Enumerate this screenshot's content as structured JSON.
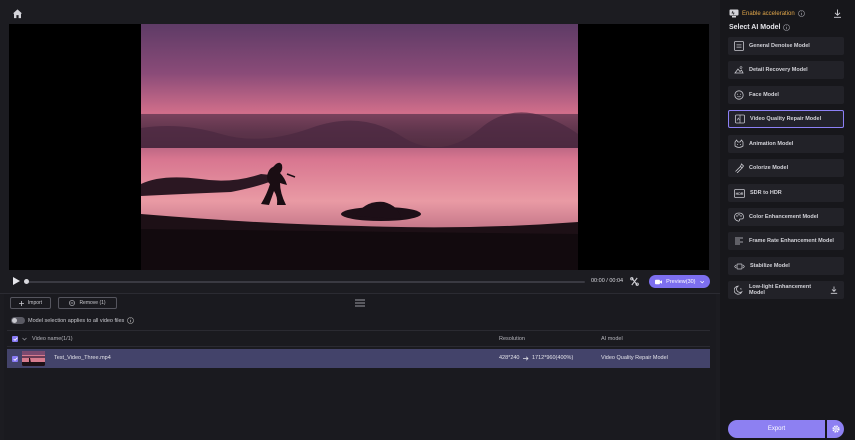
{
  "player": {
    "timecode": "00:00 / 00:04",
    "progress": 0,
    "preview_label": "Preview(30)"
  },
  "toolbar": {
    "import_label": "Import",
    "remove_label": "Remove (1)"
  },
  "toggle": {
    "label": "Model selection applies to all video files",
    "on": false
  },
  "table": {
    "headers": {
      "name": "Video name(1/1)",
      "resolution": "Resolution",
      "model": "AI model"
    },
    "rows": [
      {
        "name": "Test_Video_Three.mp4",
        "res_from": "428*240",
        "res_to": "1712*960(400%)",
        "model": "Video Quality Repair Model",
        "checked": true
      }
    ]
  },
  "side": {
    "accel_label": "Enable acceleration",
    "title": "Select AI Model",
    "models": [
      {
        "label": "General Denoise Model",
        "icon": "denoise-icon",
        "selected": false
      },
      {
        "label": "Detail Recovery Model",
        "icon": "detail-icon",
        "selected": false
      },
      {
        "label": "Face Model",
        "icon": "face-icon",
        "selected": false
      },
      {
        "label": "Video Quality Repair Model",
        "icon": "repair-icon",
        "selected": true
      },
      {
        "label": "Animation Model",
        "icon": "animation-icon",
        "selected": false
      },
      {
        "label": "Colorize Model",
        "icon": "colorize-icon",
        "selected": false
      },
      {
        "label": "SDR to HDR",
        "icon": "hdr-icon",
        "selected": false
      },
      {
        "label": "Color Enhancement Model",
        "icon": "color-enhance-icon",
        "selected": false
      },
      {
        "label": "Frame Rate Enhancement Model",
        "icon": "frame-rate-icon",
        "selected": false
      },
      {
        "label": "Stabilize Model",
        "icon": "stabilize-icon",
        "selected": false
      },
      {
        "label": "Low-light Enhancement Model",
        "icon": "low-light-icon",
        "selected": false,
        "download": true
      }
    ],
    "export_label": "Export"
  },
  "colors": {
    "accent": "#8d80f2",
    "accel": "#e0a64a",
    "selected_row": "#43436a"
  }
}
